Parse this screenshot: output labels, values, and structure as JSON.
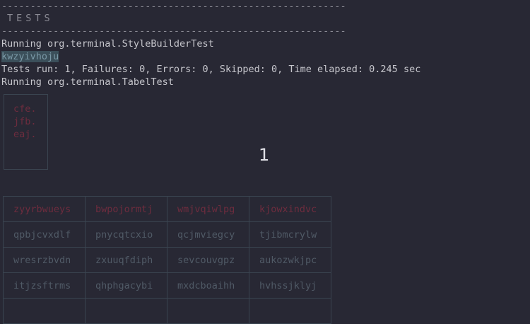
{
  "terminal": {
    "rule": "------------------------------------------------------------",
    "tests_heading": "TESTS",
    "running_1": "Running org.terminal.StyleBuilderTest",
    "highlighted_word": "kwzyivhoju",
    "results": "Tests run: 1, Failures: 0, Errors: 0, Skipped: 0, Time elapsed: 0.245 sec",
    "running_2": "Running org.terminal.TabelTest"
  },
  "box": {
    "items": [
      "cfe.",
      "jfb.",
      "eaj."
    ]
  },
  "counter": "1",
  "table": {
    "headers": [
      "zyyrbwueys",
      "bwpojormtj",
      "wmjvqiwlpg",
      "kjowxindvc"
    ],
    "rows": [
      [
        "qpbjcvxdlf",
        "pnycqtcxio",
        "qcjmviegcy",
        "tjibmcrylw"
      ],
      [
        "wresrzbvdn",
        "zxuuqfdiph",
        "sevcouvgpz",
        "aukozwkjpc"
      ],
      [
        "itjzsftrms",
        "qhphgacybi",
        "mxdcboaihh",
        "hvhssjklyj"
      ],
      [
        "",
        "",
        "",
        ""
      ]
    ]
  },
  "colors": {
    "background": "#282834",
    "text": "#c6c6cc",
    "muted_red": "#6e2c3e",
    "border": "#3a4450",
    "highlight_bg": "#3b4f5a"
  }
}
